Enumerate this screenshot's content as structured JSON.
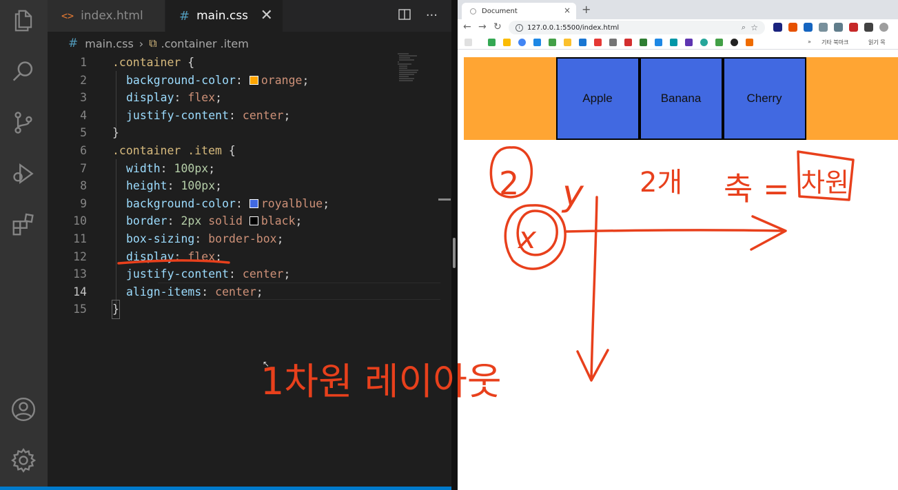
{
  "editor": {
    "tabs": [
      {
        "label": "index.html",
        "icon": "html-icon"
      },
      {
        "label": "main.css",
        "icon": "css-icon",
        "close": "✕"
      }
    ],
    "breadcrumb": {
      "file": "main.css",
      "symbol": ".container .item"
    },
    "lines": [
      {
        "num": "1"
      },
      {
        "num": "2"
      },
      {
        "num": "3"
      },
      {
        "num": "4"
      },
      {
        "num": "5"
      },
      {
        "num": "6"
      },
      {
        "num": "7"
      },
      {
        "num": "8"
      },
      {
        "num": "9"
      },
      {
        "num": "10"
      },
      {
        "num": "11"
      },
      {
        "num": "12"
      },
      {
        "num": "13"
      },
      {
        "num": "14"
      },
      {
        "num": "15"
      }
    ],
    "code": {
      "l1_sel": ".container",
      "l1_brace": " {",
      "l2_prop": "background-color",
      "l2_val": "orange",
      "l3_prop": "display",
      "l3_val": "flex",
      "l4_prop": "justify-content",
      "l4_val": "center",
      "l5": "}",
      "l6_sel": ".container .item",
      "l6_brace": " {",
      "l7_prop": "width",
      "l7_val": "100px",
      "l8_prop": "height",
      "l8_val": "100px",
      "l9_prop": "background-color",
      "l9_val": "royalblue",
      "l10_prop": "border",
      "l10_num": "2px",
      "l10_val": " solid ",
      "l10_color": "black",
      "l11_prop": "box-sizing",
      "l11_val": "border-box",
      "l12_prop": "display",
      "l12_val": "flex",
      "l13_prop": "justify-content",
      "l13_val": "center",
      "l14_prop": "align-items",
      "l14_val": "center",
      "l15": "}"
    },
    "swatches": {
      "orange": "#ffa500",
      "royalblue": "#4169e1",
      "black": "#000000"
    },
    "active_line": "14"
  },
  "browser": {
    "tab_title": "Document",
    "tab_close": "×",
    "new_tab": "+",
    "url": "127.0.0.1:5500/index.html",
    "bookmarks_right": [
      "기타 북마크",
      "읽기 목"
    ],
    "items": [
      "Apple",
      "Banana",
      "Cherry"
    ],
    "container_color": "#ffa533",
    "item_color": "#4169e1"
  },
  "annotations": {
    "left_text": "1차원 레이아웃",
    "circle_2": "2",
    "y_label": "y",
    "x_label": "x",
    "count_text": "2개",
    "axis_text": "축 =",
    "dimension_text": "차원"
  }
}
